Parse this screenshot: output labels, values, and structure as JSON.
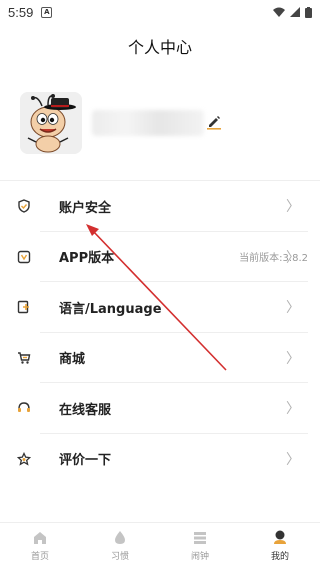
{
  "status_bar": {
    "time": "5:59",
    "notif_letter": "A"
  },
  "header": {
    "title": "个人中心"
  },
  "profile": {
    "edit_icon": "pencil-icon"
  },
  "menu": {
    "items": [
      {
        "label": "账户安全",
        "sub": "",
        "icon": "shield-icon"
      },
      {
        "label": "APP版本",
        "sub": "当前版本:3.8.2",
        "icon": "version-icon"
      },
      {
        "label": "语言/Language",
        "sub": "",
        "icon": "language-icon"
      },
      {
        "label": "商城",
        "sub": "",
        "icon": "cart-icon"
      },
      {
        "label": "在线客服",
        "sub": "",
        "icon": "headset-icon"
      },
      {
        "label": "评价一下",
        "sub": "",
        "icon": "star-icon"
      }
    ],
    "chevron": "〉"
  },
  "bottom_nav": {
    "items": [
      {
        "label": "首页",
        "icon": "home-icon"
      },
      {
        "label": "习惯",
        "icon": "drop-icon"
      },
      {
        "label": "闹钟",
        "icon": "alarm-icon"
      },
      {
        "label": "我的",
        "icon": "profile-icon"
      }
    ],
    "active_index": 3
  },
  "colors": {
    "accent": "#e8a33a",
    "arrow": "#d32f2f",
    "active_dark": "#333333"
  }
}
